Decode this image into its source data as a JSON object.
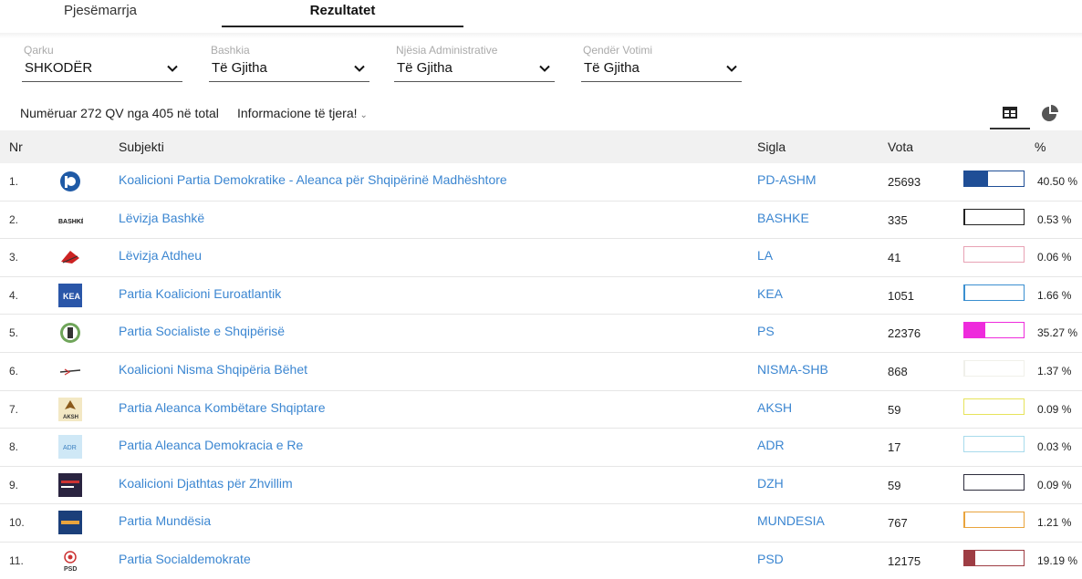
{
  "tabs": [
    "Pjesëmarrja",
    "Rezultatet"
  ],
  "filters": [
    {
      "label": "Qarku",
      "value": "SHKODËR"
    },
    {
      "label": "Bashkia",
      "value": "Të Gjitha"
    },
    {
      "label": "Njësia Administrative",
      "value": "Të Gjitha"
    },
    {
      "label": "Qendër Votimi",
      "value": "Të Gjitha"
    }
  ],
  "counted_text": "Numëruar 272 QV nga 405 në total",
  "more_info": "Informacione të tjera!",
  "columns": {
    "nr": "Nr",
    "subject": "Subjekti",
    "sigla": "Sigla",
    "vota": "Vota",
    "pct": "%"
  },
  "rows": [
    {
      "nr": "1.",
      "name": "Koalicioni Partia Demokratike - Aleanca për Shqipërinë Madhështore",
      "sigla": "PD-ASHM",
      "votes": "25693",
      "pct": "40.50 %",
      "pct_value": 40.5,
      "color": "#1f4e96",
      "logo": "pd-logo-icon"
    },
    {
      "nr": "2.",
      "name": "Lëvizja Bashkë",
      "sigla": "BASHKE",
      "votes": "335",
      "pct": "0.53 %",
      "pct_value": 0.53,
      "color": "#222222",
      "logo": "bashke-logo-icon"
    },
    {
      "nr": "3.",
      "name": "Lëvizja Atdheu",
      "sigla": "LA",
      "votes": "41",
      "pct": "0.06 %",
      "pct_value": 0.06,
      "color": "#e8a2b4",
      "logo": "atdheu-logo-icon"
    },
    {
      "nr": "4.",
      "name": "Partia Koalicioni Euroatlantik",
      "sigla": "KEA",
      "votes": "1051",
      "pct": "1.66 %",
      "pct_value": 1.66,
      "color": "#3a8fd0",
      "logo": "kea-logo-icon"
    },
    {
      "nr": "5.",
      "name": "Partia Socialiste e Shqipërisë",
      "sigla": "PS",
      "votes": "22376",
      "pct": "35.27 %",
      "pct_value": 35.27,
      "color": "#ee2bdc",
      "logo": "ps-logo-icon"
    },
    {
      "nr": "6.",
      "name": "Koalicioni Nisma Shqipëria Bëhet",
      "sigla": "NISMA-SHB",
      "votes": "868",
      "pct": "1.37 %",
      "pct_value": 1.37,
      "color": "#f0f0ea",
      "logo": "nisma-logo-icon"
    },
    {
      "nr": "7.",
      "name": "Partia Aleanca Kombëtare Shqiptare",
      "sigla": "AKSH",
      "votes": "59",
      "pct": "0.09 %",
      "pct_value": 0.09,
      "color": "#e6e35b",
      "logo": "aksh-logo-icon"
    },
    {
      "nr": "8.",
      "name": "Partia Aleanca Demokracia e Re",
      "sigla": "ADR",
      "votes": "17",
      "pct": "0.03 %",
      "pct_value": 0.03,
      "color": "#a8dbec",
      "logo": "adr-logo-icon"
    },
    {
      "nr": "9.",
      "name": "Koalicioni Djathtas për Zhvillim",
      "sigla": "DZH",
      "votes": "59",
      "pct": "0.09 %",
      "pct_value": 0.09,
      "color": "#2c2c3c",
      "logo": "dzh-logo-icon"
    },
    {
      "nr": "10.",
      "name": "Partia Mundësia",
      "sigla": "MUNDESIA",
      "votes": "767",
      "pct": "1.21 %",
      "pct_value": 1.21,
      "color": "#e9a43d",
      "logo": "mundesia-logo-icon"
    },
    {
      "nr": "11.",
      "name": "Partia Socialdemokrate",
      "sigla": "PSD",
      "votes": "12175",
      "pct": "19.19 %",
      "pct_value": 19.19,
      "color": "#9e3d44",
      "logo": "psd-logo-icon"
    }
  ]
}
